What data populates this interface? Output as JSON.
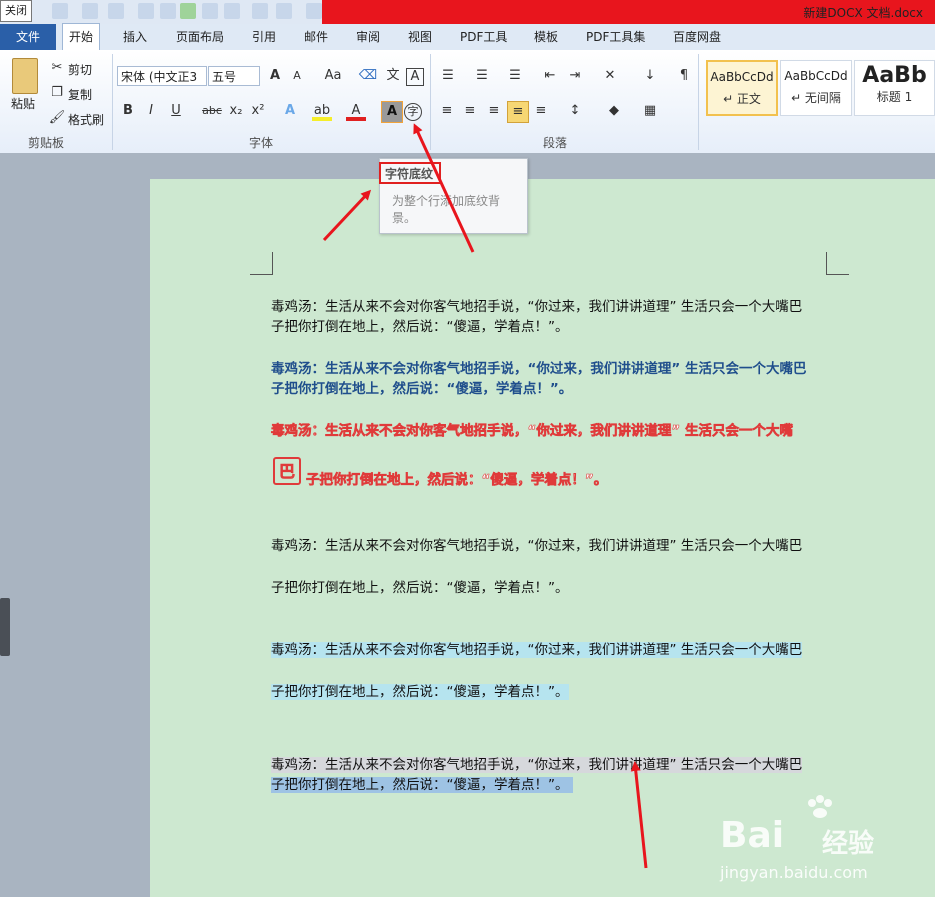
{
  "title_bar": {
    "close_tooltip": "关闭",
    "doc_title": "新建DOCX 文档.docx"
  },
  "tabs": [
    {
      "label": "文件"
    },
    {
      "label": "开始"
    },
    {
      "label": "插入"
    },
    {
      "label": "页面布局"
    },
    {
      "label": "引用"
    },
    {
      "label": "邮件"
    },
    {
      "label": "审阅"
    },
    {
      "label": "视图"
    },
    {
      "label": "PDF工具"
    },
    {
      "label": "模板"
    },
    {
      "label": "PDF工具集"
    },
    {
      "label": "百度网盘"
    }
  ],
  "clipboard": {
    "paste": "粘贴",
    "cut": "剪切",
    "copy": "复制",
    "format_painter": "格式刷",
    "group_label": "剪贴板"
  },
  "font": {
    "font_name": "宋体 (中文正3",
    "font_size": "五号",
    "group_label": "字体",
    "buttons": {
      "bold": "B",
      "italic": "I",
      "underline": "U",
      "strike": "abc",
      "subscript": "x₂",
      "superscript": "x²",
      "grow": "A",
      "shrink": "A",
      "case": "Aa",
      "char_shade": "A",
      "enclose": "字"
    }
  },
  "paragraph": {
    "group_label": "段落"
  },
  "styles": [
    {
      "sample": "AaBbCcDd",
      "name": "↵ 正文"
    },
    {
      "sample": "AaBbCcDd",
      "name": "↵ 无间隔"
    },
    {
      "sample": "AaBb",
      "name": "标题 1"
    }
  ],
  "tooltip": {
    "title": "字符底纹",
    "description": "为整个行添加底纹背景。"
  },
  "document": {
    "p1_line1": "毒鸡汤：生活从来不会对你客气地招手说，“你过来，我们讲讲道理” 生活只会一个大嘴巴",
    "p1_line2": "子把你打倒在地上，然后说：“傻逼，学着点！”。",
    "p2_line1": "毒鸡汤：生活从来不会对你客气地招手说，“你过来，我们讲讲道理” 生活只会一个大嘴巴",
    "p2_line2": "子把你打倒在地上，然后说：“傻逼，学着点！”。",
    "p3_line1": "毒鸡汤：生活从来不会对你客气地招手说，“你过来，我们讲讲道理” 生活只会一个大嘴",
    "p3_enclosed": "巴",
    "p3_line2": "子把你打倒在地上，然后说：“傻逼，学着点！”。",
    "p4_line1": "毒鸡汤：生活从来不会对你客气地招手说，“你过来，我们讲讲道理” 生活只会一个大嘴巴",
    "p4_line2": "子把你打倒在地上，然后说：“傻逼，学着点！”。",
    "p5_line1": "毒鸡汤：生活从来不会对你客气地招手说，“你过来，我们讲讲道理” 生活只会一个大嘴巴",
    "p5_line2": "子把你打倒在地上，然后说：“傻逼，学着点！”。",
    "p6_line1": "毒鸡汤：生活从来不会对你客气地招手说，“你过来，我们讲讲道理” 生活只会一个大嘴巴",
    "p6_line2": "子把你打倒在地上，然后说：“傻逼，学着点！”。"
  },
  "watermark": {
    "brand": "Bai",
    "brand_cn": "经验",
    "url": "jingyan.baidu.com"
  },
  "colors": {
    "annotation_red": "#e8151d",
    "page_green": "#cde8d0",
    "file_tab_blue": "#2a5fa8"
  }
}
